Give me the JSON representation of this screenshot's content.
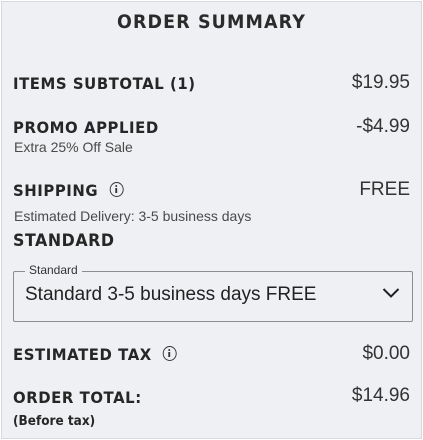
{
  "summary": {
    "title": "ORDER SUMMARY",
    "items_subtotal": {
      "label": "ITEMS SUBTOTAL (1)",
      "value": "$19.95"
    },
    "promo": {
      "label": "PROMO APPLIED",
      "value": "-$4.99",
      "detail": "Extra 25% Off Sale"
    },
    "shipping": {
      "label": "SHIPPING",
      "value": "FREE",
      "estimated_delivery": "Estimated Delivery: 3-5 business days",
      "method": "STANDARD",
      "select": {
        "legend": "Standard",
        "selected": "Standard 3-5 business days FREE"
      }
    },
    "tax": {
      "label": "ESTIMATED TAX",
      "value": "$0.00"
    },
    "total": {
      "label": "ORDER TOTAL:",
      "note": "(Before tax)",
      "value": "$14.96"
    }
  },
  "icons": {
    "info": "info-circle-icon",
    "dropdown": "chevron-down-icon"
  },
  "colors": {
    "panel_background": "#eef0f3",
    "text": "#222222",
    "border": "#8a8d92"
  }
}
